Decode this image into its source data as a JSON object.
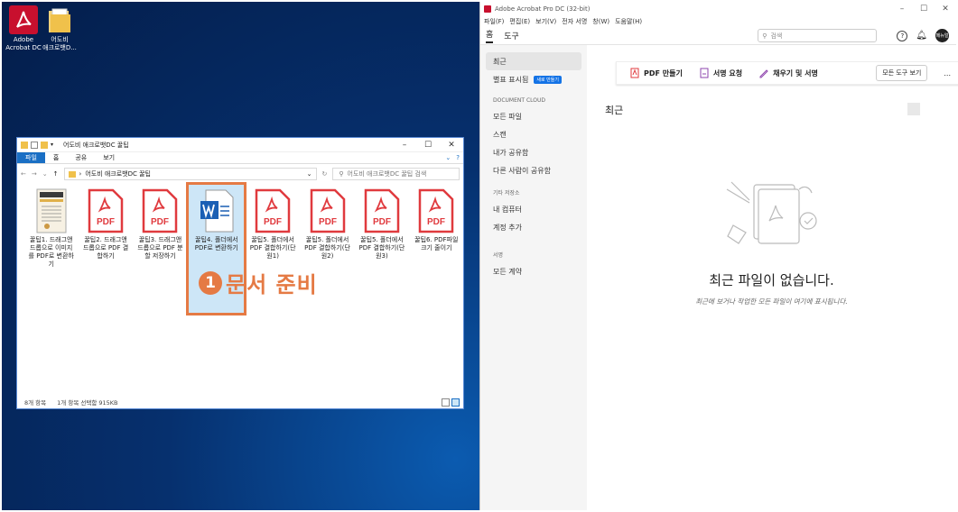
{
  "desktop": {
    "icons": [
      {
        "label_line1": "Adobe",
        "label_line2": "Acrobat DC"
      },
      {
        "label_line1": "어도비",
        "label_line2": "애크로뱃D..."
      }
    ]
  },
  "explorer": {
    "title": "어도비 애크로뱃DC 꿀팁",
    "ribbon_tabs": [
      "파일",
      "홈",
      "공유",
      "보기"
    ],
    "path": "어도비 애크로뱃DC 꿀팁",
    "search_placeholder": "어도비 애크로뱃DC 꿀팁 검색",
    "files": [
      {
        "label": "꿀팁1. 드래그앤드롭으로 이미지를 PDF로 변환하기",
        "type": "book",
        "pdf_text": ""
      },
      {
        "label": "꿀팁2. 드래그앤드롭으로 PDF 결합하기",
        "type": "pdf",
        "pdf_text": "PDF"
      },
      {
        "label": "꿀팁3. 드래그앤드롭으로 PDF 분할 저장하기",
        "type": "pdf",
        "pdf_text": "PDF"
      },
      {
        "label": "꿀팁4. 폴더에서 PDF로 변환하기",
        "type": "word",
        "pdf_text": ""
      },
      {
        "label": "꿀팁5. 폴더에서 PDF 결합하기(단원1)",
        "type": "pdf",
        "pdf_text": "PDF"
      },
      {
        "label": "꿀팁5. 폴더에서 PDF 결합하기(단원2)",
        "type": "pdf",
        "pdf_text": "PDF"
      },
      {
        "label": "꿀팁5. 폴더에서 PDF 결합하기(단원3)",
        "type": "pdf",
        "pdf_text": "PDF"
      },
      {
        "label": "꿀팁6. PDF파일 크기 줄이기",
        "type": "pdf",
        "pdf_text": "PDF"
      }
    ],
    "status_count": "8개 항목",
    "status_selected": "1개 항목 선택함 915KB"
  },
  "callout": {
    "number": "1",
    "text": "문서 준비"
  },
  "acrobat": {
    "title": "Adobe Acrobat Pro DC (32-bit)",
    "menu": [
      "파일(F)",
      "편집(E)",
      "보기(V)",
      "전자 서명",
      "창(W)",
      "도움말(H)"
    ],
    "top_tabs": [
      "홈",
      "도구"
    ],
    "search_placeholder": "검색",
    "avatar": "메뉴얼",
    "sidebar": {
      "recent": "최근",
      "starred": "별표 표시됨",
      "starred_badge": "새로 만들기",
      "doc_cloud": "DOCUMENT CLOUD",
      "cloud_items": [
        "모든 파일",
        "스캔",
        "내가 공유함",
        "다른 사람이 공유함"
      ],
      "other_storage": "기타 저장소",
      "storage_items": [
        "내 컴퓨터",
        "계정 추가"
      ],
      "agreement": "서명",
      "agreement_items": [
        "모든 계약"
      ]
    },
    "toolbar": {
      "tools": [
        "PDF 만들기",
        "서명 요청",
        "채우기 및 서명"
      ],
      "all_tools": "모든 도구 보기",
      "more": "..."
    },
    "recent_heading": "최근",
    "empty_title": "최근 파일이 없습니다.",
    "empty_sub": "최근에 보거나 작업한 모든 파일이 여기에 표시됩니다."
  }
}
